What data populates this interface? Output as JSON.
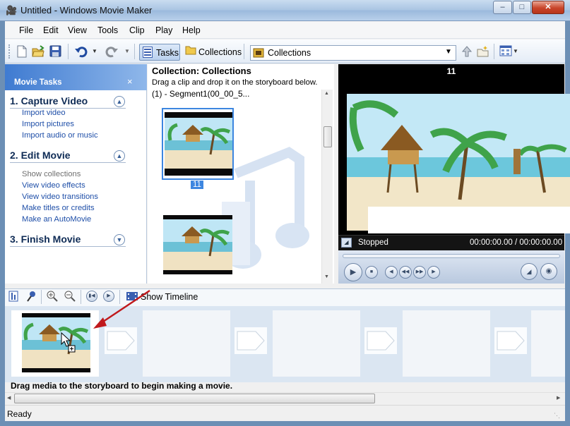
{
  "window": {
    "title": "Untitled - Windows Movie Maker",
    "minimize": "–",
    "maximize": "□",
    "close": "✕"
  },
  "menu": [
    "File",
    "Edit",
    "View",
    "Tools",
    "Clip",
    "Play",
    "Help"
  ],
  "toolbar": {
    "tasks_label": "Tasks",
    "collections_label": "Collections",
    "collection_dropdown": "Collections"
  },
  "task_pane": {
    "header": "Movie Tasks",
    "close": "×",
    "sections": [
      {
        "title": "1. Capture Video",
        "items": [
          "Import video",
          "Import pictures",
          "Import audio or music"
        ]
      },
      {
        "title": "2. Edit Movie",
        "items": [
          "Show collections",
          "View video effects",
          "View video transitions",
          "Make titles or credits",
          "Make an AutoMovie"
        ]
      },
      {
        "title": "3. Finish Movie",
        "items": []
      }
    ]
  },
  "collection": {
    "title": "Collection: Collections",
    "subtitle": "Drag a clip and drop it on the storyboard below.",
    "segment": "(1) - Segment1(00_00_5...",
    "clips": [
      {
        "label": "11",
        "selected": true
      },
      {
        "label": "",
        "selected": false
      }
    ]
  },
  "preview": {
    "title": "11",
    "status": "Stopped",
    "time": "00:00:00.00 / 00:00:00.00"
  },
  "storyboard": {
    "show_timeline": "Show Timeline",
    "message": "Drag media to the storyboard to begin making a movie."
  },
  "status": "Ready",
  "colors": {
    "accent": "#3f7bd1",
    "link": "#1f4fa8",
    "arrow": "#c0191c",
    "selection": "#3d86e0"
  }
}
